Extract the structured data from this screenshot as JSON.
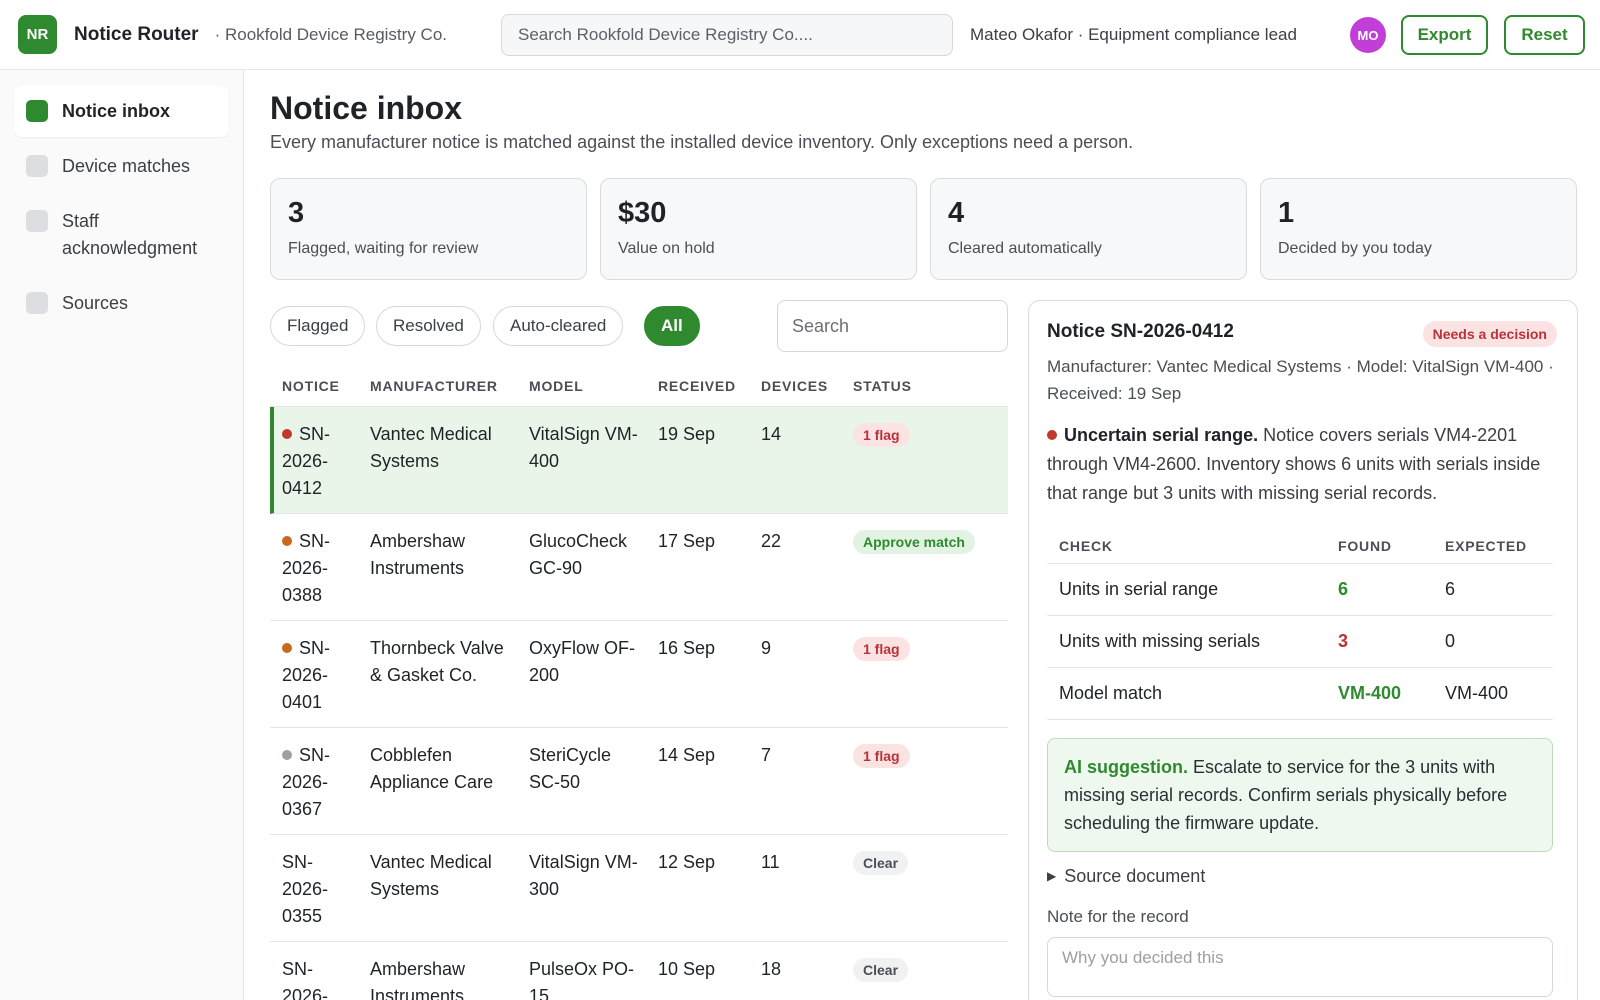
{
  "header": {
    "logo_text": "NR",
    "app_title": "Notice Router",
    "org": "· Rookfold Device Registry Co.",
    "search_placeholder": "Search Rookfold Device Registry Co....",
    "user_label": "Mateo Okafor · Equipment compliance lead",
    "avatar_initials": "MO",
    "export_label": "Export",
    "reset_label": "Reset"
  },
  "sidebar": {
    "items": [
      {
        "label": "Notice inbox"
      },
      {
        "label": "Device matches"
      },
      {
        "label": "Staff acknowledgment"
      },
      {
        "label": "Sources"
      }
    ]
  },
  "page": {
    "title": "Notice inbox",
    "subtitle": "Every manufacturer notice is matched against the installed device inventory. Only exceptions need a person."
  },
  "stats": [
    {
      "value": "3",
      "label": "Flagged, waiting for review"
    },
    {
      "value": "$30",
      "label": "Value on hold"
    },
    {
      "value": "4",
      "label": "Cleared automatically"
    },
    {
      "value": "1",
      "label": "Decided by you today"
    }
  ],
  "filters": {
    "chips": [
      "Flagged",
      "Resolved",
      "Auto-cleared",
      "All"
    ],
    "active": "All",
    "search_placeholder": "Search"
  },
  "table": {
    "headers": [
      "NOTICE",
      "MANUFACTURER",
      "MODEL",
      "RECEIVED",
      "DEVICES",
      "STATUS"
    ],
    "rows": [
      {
        "notice": "SN-2026-0412",
        "manufacturer": "Vantec Medical Systems",
        "model": "VitalSign VM-400",
        "received": "19 Sep",
        "devices": "14",
        "status": "1 flag",
        "dot": "#c0392b"
      },
      {
        "notice": "SN-2026-0388",
        "manufacturer": "Ambershaw Instruments",
        "model": "GlucoCheck GC-90",
        "received": "17 Sep",
        "devices": "22",
        "status": "Approve match",
        "dot": "#c76a1a"
      },
      {
        "notice": "SN-2026-0401",
        "manufacturer": "Thornbeck Valve & Gasket Co.",
        "model": "OxyFlow OF-200",
        "received": "16 Sep",
        "devices": "9",
        "status": "1 flag",
        "dot": "#c76a1a"
      },
      {
        "notice": "SN-2026-0367",
        "manufacturer": "Cobblefen Appliance Care",
        "model": "SteriCycle SC-50",
        "received": "14 Sep",
        "devices": "7",
        "status": "1 flag",
        "dot": "#9aa0a6"
      },
      {
        "notice": "SN-2026-0355",
        "manufacturer": "Vantec Medical Systems",
        "model": "VitalSign VM-300",
        "received": "12 Sep",
        "devices": "11",
        "status": "Clear",
        "dot": ""
      },
      {
        "notice": "SN-2026-",
        "manufacturer": "Ambershaw Instruments",
        "model": "PulseOx PO-15",
        "received": "10 Sep",
        "devices": "18",
        "status": "Clear",
        "dot": ""
      }
    ]
  },
  "detail": {
    "title": "Notice SN-2026-0412",
    "badge": "Needs a decision",
    "meta": "Manufacturer: Vantec Medical Systems · Model: VitalSign VM-400 · Received: 19 Sep",
    "issue_title": "Uncertain serial range.",
    "issue_text": " Notice covers serials VM4-2201 through VM4-2600. Inventory shows 6 units with serials inside that range but 3 units with missing serial records.",
    "checks_headers": [
      "CHECK",
      "FOUND",
      "EXPECTED"
    ],
    "checks": [
      {
        "check": "Units in serial range",
        "found": "6",
        "expected": "6",
        "ok": true
      },
      {
        "check": "Units with missing serials",
        "found": "3",
        "expected": "0",
        "ok": false
      },
      {
        "check": "Model match",
        "found": "VM-400",
        "expected": "VM-400",
        "ok": true
      }
    ],
    "ai_label": "AI suggestion.",
    "ai_text": " Escalate to service for the 3 units with missing serial records. Confirm serials physically before scheduling the firmware update.",
    "source_label": "Source document",
    "note_label": "Note for the record",
    "note_placeholder": "Why you decided this"
  },
  "colors": {
    "accent": "#2f8a2f",
    "flag": "#b8323a",
    "avatar": "#c23ed8"
  }
}
